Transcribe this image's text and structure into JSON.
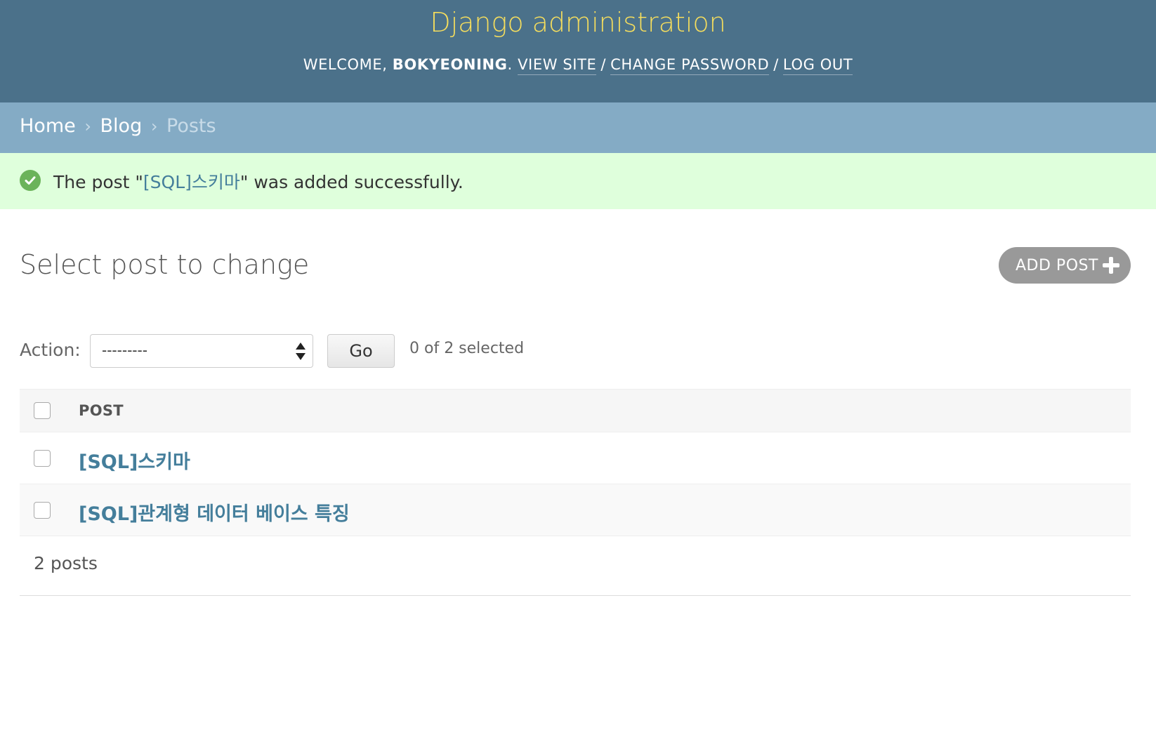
{
  "header": {
    "site_name": "Django administration",
    "welcome_prefix": "WELCOME, ",
    "username": "BOKYEONING",
    "welcome_suffix": ".",
    "view_site": "VIEW SITE",
    "change_password": "CHANGE PASSWORD",
    "log_out": "LOG OUT",
    "separator": "/"
  },
  "breadcrumbs": {
    "home": "Home",
    "app": "Blog",
    "current": "Posts",
    "arrow": "›"
  },
  "message": {
    "prefix": "The post \"",
    "link": "[SQL]스키마",
    "suffix": "\" was added successfully.",
    "icon": "check-circle-icon",
    "color": "#dfffdc"
  },
  "page": {
    "title": "Select post to change",
    "add_button": "ADD POST"
  },
  "actions": {
    "label": "Action:",
    "selected_value": "---------",
    "go": "Go",
    "selected_count": "0 of 2 selected"
  },
  "table": {
    "column": "POST",
    "rows": [
      "[SQL]스키마",
      "[SQL]관계형 데이터 베이스 특징"
    ]
  },
  "paginator": {
    "count": "2 posts"
  },
  "colors": {
    "header_bg": "#4b718a",
    "brand": "#f5dd5d",
    "breadcrumb_bg": "#84abc5",
    "link": "#447e9b",
    "add_button_bg": "#999999"
  }
}
